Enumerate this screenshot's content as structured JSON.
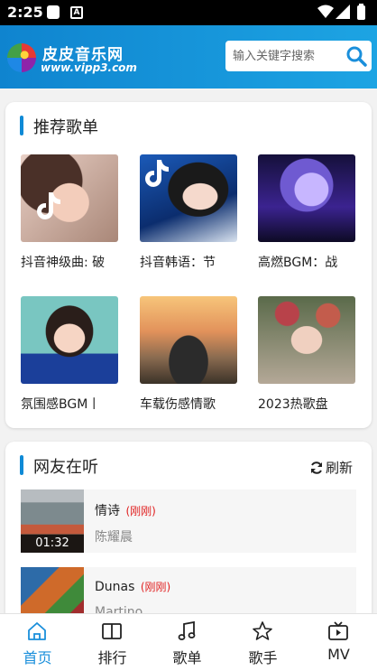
{
  "status_bar": {
    "time": "2:25",
    "notif_icon_letter": "A"
  },
  "header": {
    "site_name": "皮皮音乐网",
    "site_url": "www.vipp3.com",
    "search_placeholder": "输入关键字搜索"
  },
  "recommended": {
    "title": "推荐歌单",
    "playlists": [
      {
        "name": "抖音神级曲: 破",
        "cover": "tiktok-portrait"
      },
      {
        "name": "抖音韩语：节",
        "cover": "tiktok-portrait"
      },
      {
        "name": "高燃BGM：战",
        "cover": "anime-character"
      },
      {
        "name": "氛围感BGM丨",
        "cover": "girl-portrait"
      },
      {
        "name": "车载伤感情歌",
        "cover": "pickup-truck"
      },
      {
        "name": "2023热歌盘",
        "cover": "flower-crown-portrait"
      }
    ]
  },
  "listening": {
    "title": "网友在听",
    "refresh_label": "刷新",
    "songs": [
      {
        "title": "情诗",
        "time": "(刚刚)",
        "artist": "陈耀晨",
        "duration": "01:32"
      },
      {
        "title": "Dunas",
        "time": "(刚刚)",
        "artist": "Martino",
        "duration": ""
      }
    ]
  },
  "bottom_nav": {
    "active_color": "#1a8fdb",
    "items": [
      {
        "label": "首页",
        "icon": "home-icon"
      },
      {
        "label": "排行",
        "icon": "book-icon"
      },
      {
        "label": "歌单",
        "icon": "music-note-icon"
      },
      {
        "label": "歌手",
        "icon": "star-icon"
      },
      {
        "label": "MV",
        "icon": "tv-icon"
      }
    ]
  },
  "colors": {
    "header_start": "#0f84cf",
    "header_end": "#1da4e3",
    "accent_bar": "#0f8ad6",
    "timestamp": "#e02020"
  }
}
